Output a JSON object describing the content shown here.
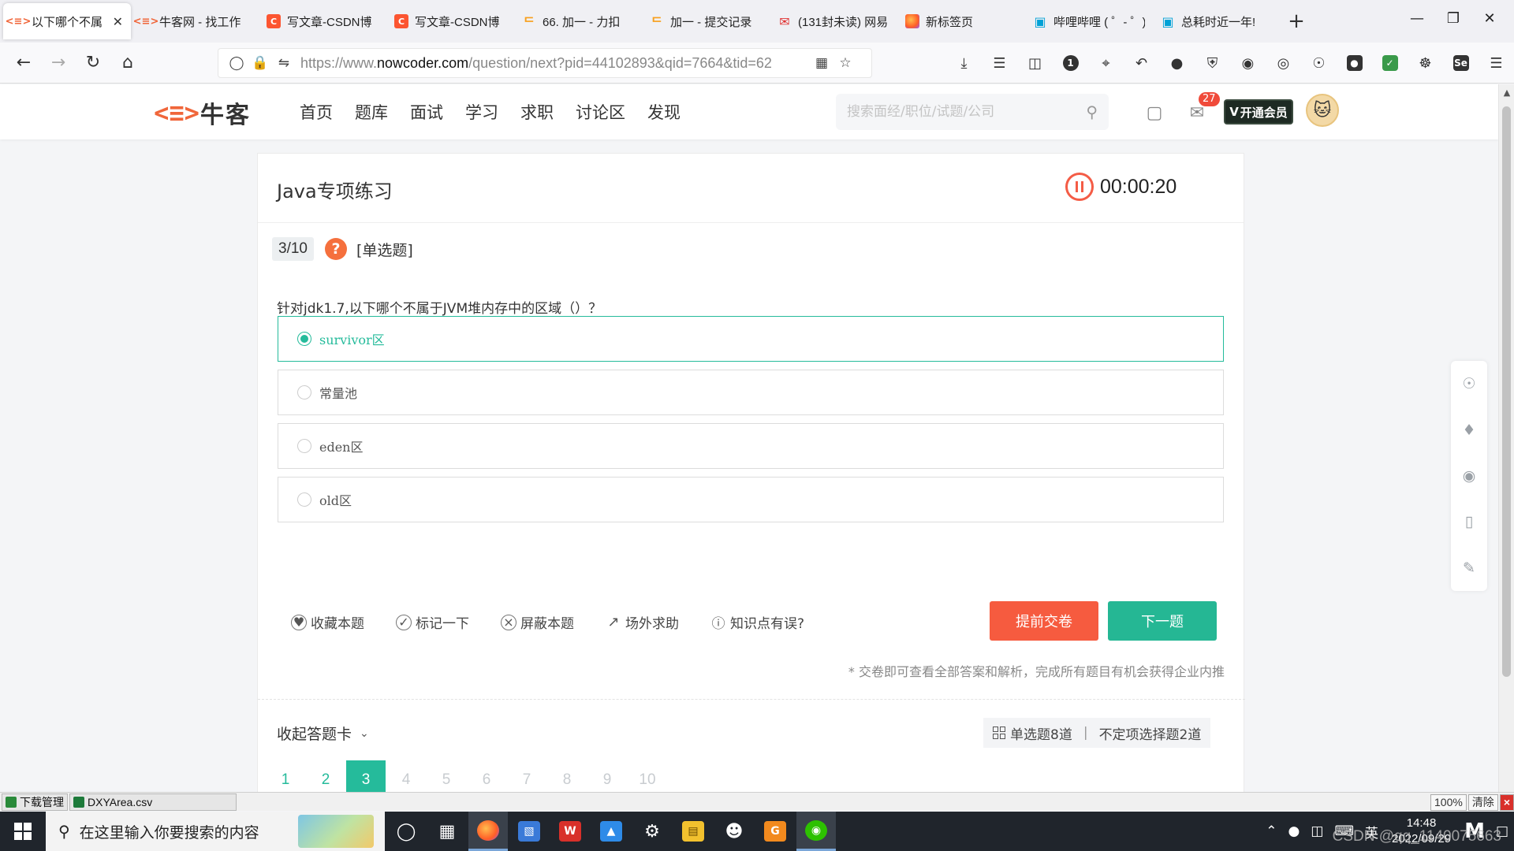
{
  "browser": {
    "tabs": [
      {
        "title": "以下哪个不属",
        "favicon": "nowcoder-logo",
        "active": true
      },
      {
        "title": "牛客网 - 找工作",
        "favicon": "nowcoder-logo"
      },
      {
        "title": "写文章-CSDN博",
        "favicon": "csdn-logo"
      },
      {
        "title": "写文章-CSDN博",
        "favicon": "csdn-logo"
      },
      {
        "title": "66. 加一 - 力扣",
        "favicon": "leetcode-logo"
      },
      {
        "title": "加一 - 提交记录",
        "favicon": "leetcode-logo"
      },
      {
        "title": "(131封未读) 网易",
        "favicon": "netease-mail-logo"
      },
      {
        "title": "新标签页",
        "favicon": "firefox-logo"
      },
      {
        "title": "哔哩哔哩 ( ゜- ゜)",
        "favicon": "bilibili-logo"
      },
      {
        "title": "总耗时近一年!",
        "favicon": "bilibili-logo"
      }
    ],
    "url_prefix": "https://www.",
    "url_domain": "nowcoder.com",
    "url_rest": "/question/next?pid=44102893&qid=7664&tid=62"
  },
  "site": {
    "logo_text": "牛客",
    "nav": [
      "首页",
      "题库",
      "面试",
      "学习",
      "求职",
      "讨论区",
      "发现"
    ],
    "search_placeholder": "搜索面经/职位/试题/公司",
    "mail_badge": "27",
    "vip_label": "开通会员",
    "vip_prefix": "V"
  },
  "quiz": {
    "title": "Java专项练习",
    "timer": "00:00:20",
    "progress": "3/10",
    "help_icon": "?",
    "question_type": "[单选题]",
    "question": "针对jdk1.7,以下哪个不属于JVM堆内存中的区域（）？",
    "options": [
      {
        "label": "survivor区",
        "selected": true
      },
      {
        "label": "常量池",
        "selected": false
      },
      {
        "label": "eden区",
        "selected": false
      },
      {
        "label": "old区",
        "selected": false
      }
    ],
    "actions": [
      "收藏本题",
      "标记一下",
      "屏蔽本题",
      "场外求助",
      "知识点有误?"
    ],
    "submit_label": "提前交卷",
    "next_label": "下一题",
    "hint": "* 交卷即可查看全部答案和解析，完成所有题目有机会获得企业内推",
    "collapse_label": "收起答题卡",
    "type_summary": {
      "single": "单选题8道",
      "multi": "不定项选择题2道"
    },
    "answer_sheet": [
      "1",
      "2",
      "3",
      "4",
      "5",
      "6",
      "7",
      "8",
      "9",
      "10"
    ],
    "current_index": 3,
    "answered_count": 2
  },
  "download_bar": {
    "manager_label": "下载管理",
    "file": "DXYArea.csv",
    "zoom": "100%",
    "clear_label": "清除",
    "close_label": "×"
  },
  "taskbar": {
    "search_placeholder": "在这里输入你要搜索的内容",
    "ime": "英",
    "time": "14:48",
    "date": "2022/09/29"
  },
  "watermark": "CSDN @qq_1140075663",
  "colors": {
    "accent_green": "#25bb9b",
    "submit_red": "#f65b3f",
    "brand_orange": "#f0663a"
  }
}
